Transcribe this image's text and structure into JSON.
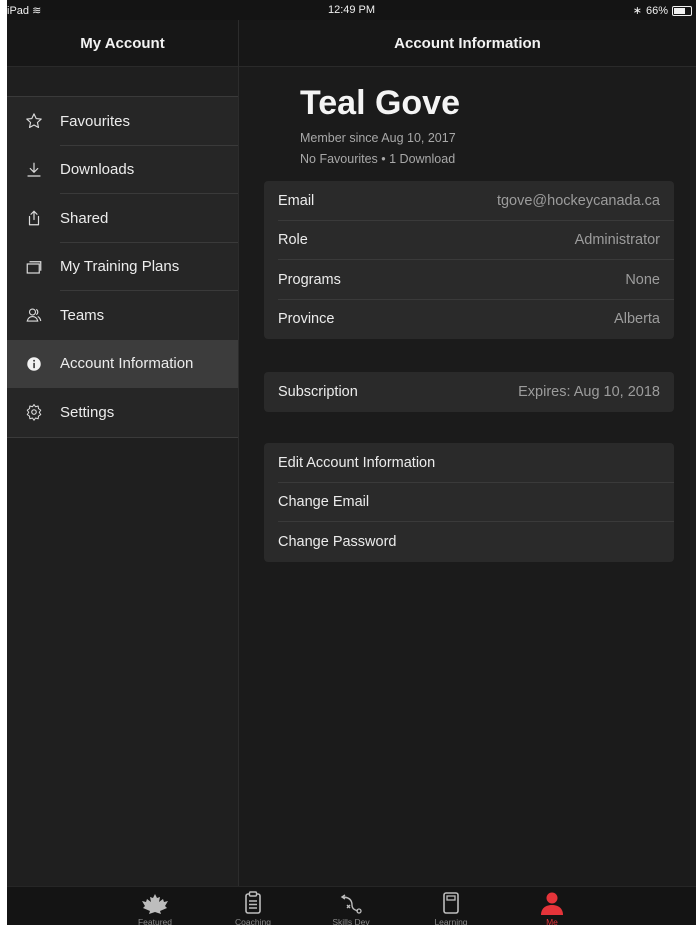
{
  "status_bar": {
    "device": "iPad",
    "time": "12:49 PM",
    "battery": "66%",
    "battery_level": 0.66
  },
  "sidebar": {
    "title": "My Account",
    "items": [
      {
        "label": "Favourites",
        "icon": "star-icon"
      },
      {
        "label": "Downloads",
        "icon": "download-icon"
      },
      {
        "label": "Shared",
        "icon": "share-icon"
      },
      {
        "label": "My Training Plans",
        "icon": "training-plans-icon"
      },
      {
        "label": "Teams",
        "icon": "teams-icon"
      },
      {
        "label": "Account Information",
        "icon": "info-icon",
        "active": true
      },
      {
        "label": "Settings",
        "icon": "gear-icon"
      }
    ]
  },
  "main": {
    "title": "Account Information",
    "profile": {
      "name": "Teal Gove",
      "member_since": "Member since Aug 10, 2017",
      "stats": "No Favourites • 1 Download"
    },
    "details": [
      {
        "label": "Email",
        "value": "tgove@hockeycanada.ca"
      },
      {
        "label": "Role",
        "value": "Administrator"
      },
      {
        "label": "Programs",
        "value": "None"
      },
      {
        "label": "Province",
        "value": "Alberta"
      }
    ],
    "subscription": {
      "label": "Subscription",
      "value": "Expires: Aug 10, 2018"
    },
    "actions": [
      {
        "label": "Edit Account Information"
      },
      {
        "label": "Change Email"
      },
      {
        "label": "Change Password"
      }
    ]
  },
  "tab_bar": {
    "active_color": "#e5343a",
    "tabs": [
      {
        "label": "Featured",
        "icon": "maple-leaf-icon"
      },
      {
        "label": "Coaching",
        "icon": "clipboard-icon"
      },
      {
        "label": "Skills Dev",
        "icon": "play-diagram-icon"
      },
      {
        "label": "Learning",
        "icon": "book-icon"
      },
      {
        "label": "Me",
        "icon": "person-icon",
        "active": true
      }
    ]
  }
}
